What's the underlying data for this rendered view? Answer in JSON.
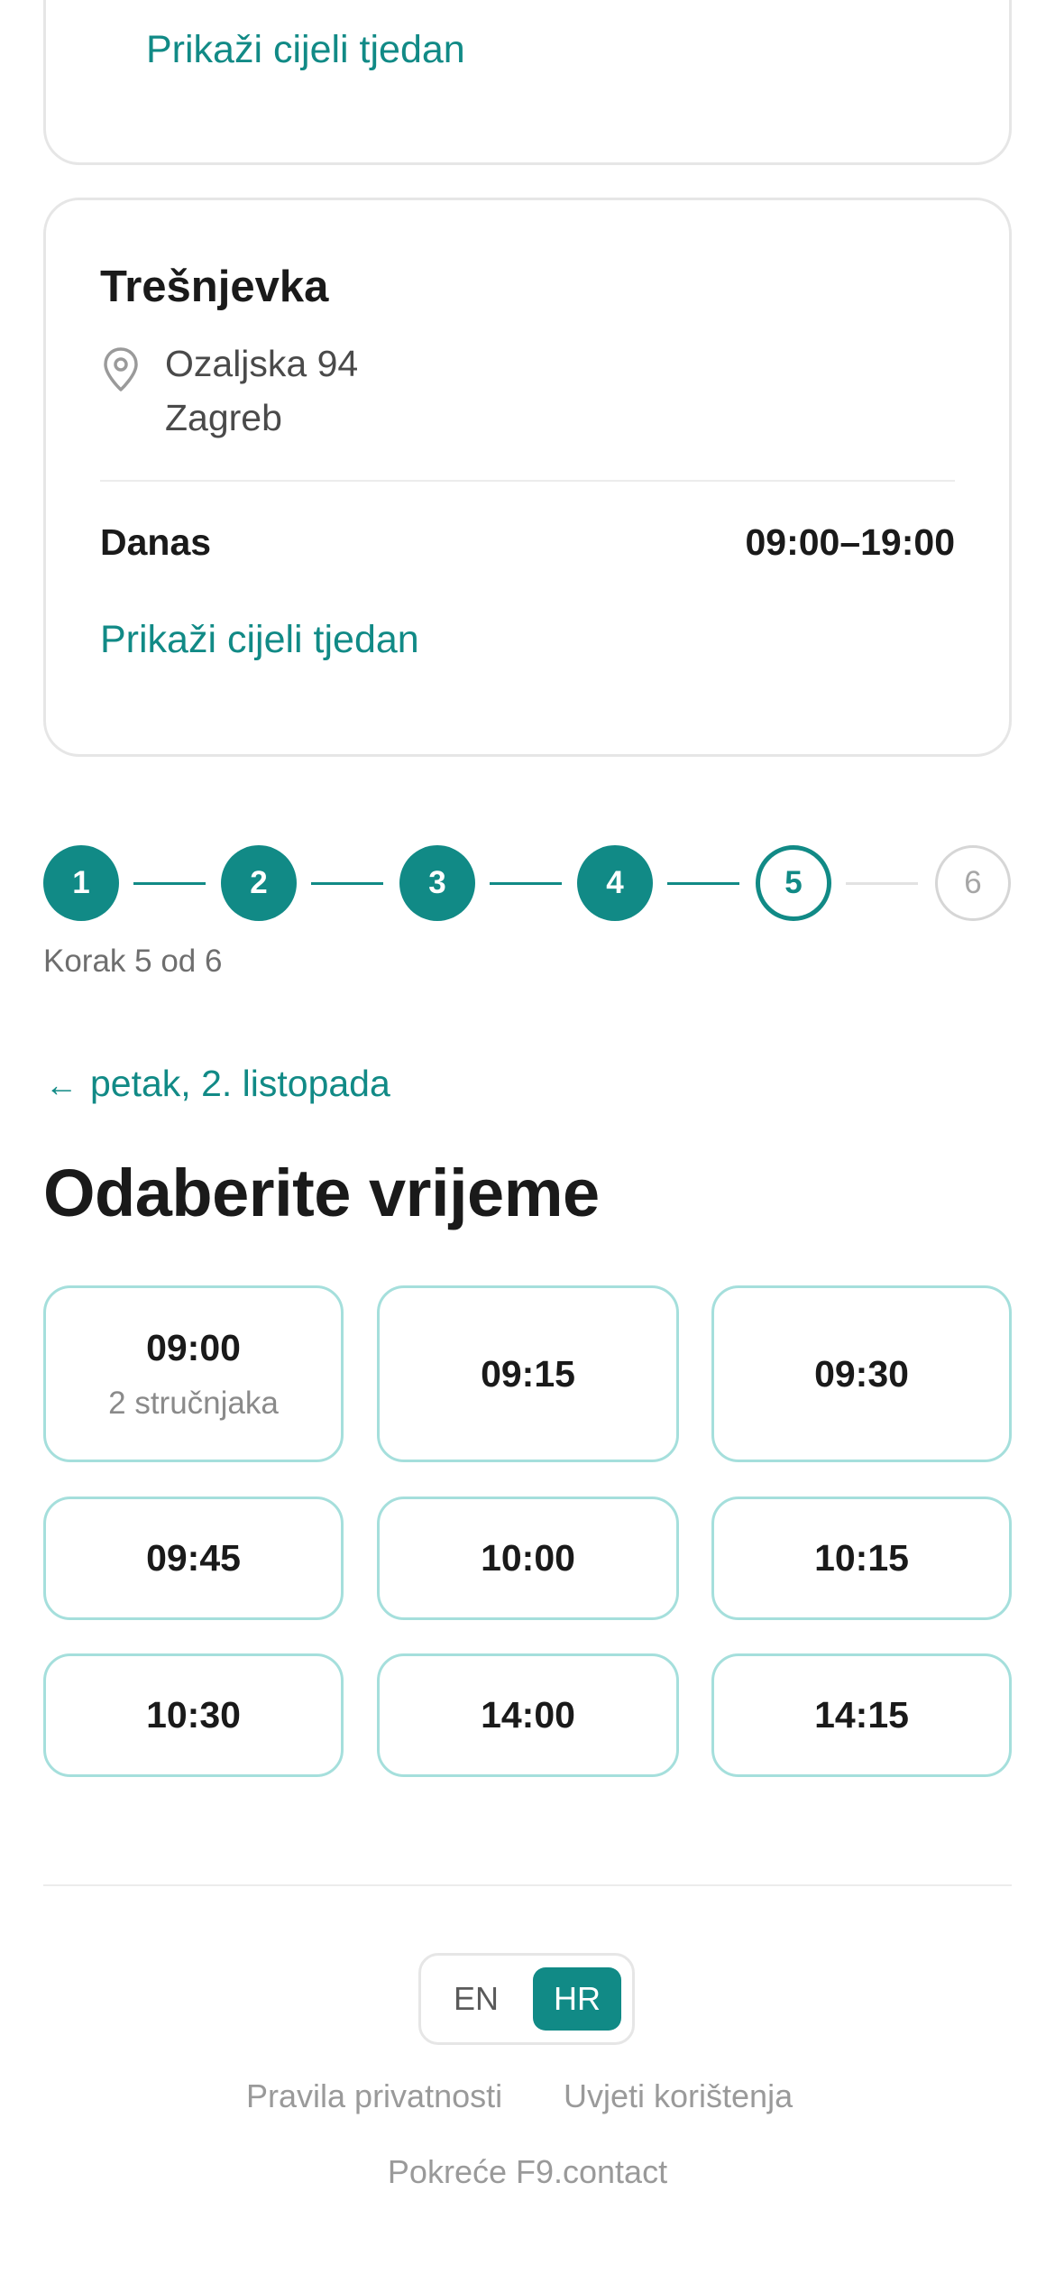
{
  "location_card_prev": {
    "week_link": "Prikaži cijeli tjedan"
  },
  "location_card": {
    "name": "Trešnjevka",
    "address_line1": "Ozaljska 94",
    "address_line2": "Zagreb",
    "today_label": "Danas",
    "today_hours": "09:00–19:00",
    "week_link": "Prikaži cijeli tjedan",
    "pin_icon": "location-pin-icon"
  },
  "stepper": {
    "steps": [
      "1",
      "2",
      "3",
      "4",
      "5",
      "6"
    ],
    "current": 5,
    "total": 6,
    "text": "Korak 5 od 6",
    "accent": "#118a86"
  },
  "back": {
    "arrow": "←",
    "label": "petak, 2. listopada"
  },
  "title": "Odaberite vrijeme",
  "slots": [
    {
      "time": "09:00",
      "sub": "2 stručnjaka"
    },
    {
      "time": "09:15"
    },
    {
      "time": "09:30"
    },
    {
      "time": "09:45"
    },
    {
      "time": "10:00"
    },
    {
      "time": "10:15"
    },
    {
      "time": "10:30"
    },
    {
      "time": "14:00"
    },
    {
      "time": "14:15"
    }
  ],
  "footer": {
    "languages": [
      "EN",
      "HR"
    ],
    "selected_language": "HR",
    "privacy": "Pravila privatnosti",
    "terms": "Uvjeti korištenja",
    "powered_by": "Pokreće F9.contact"
  }
}
